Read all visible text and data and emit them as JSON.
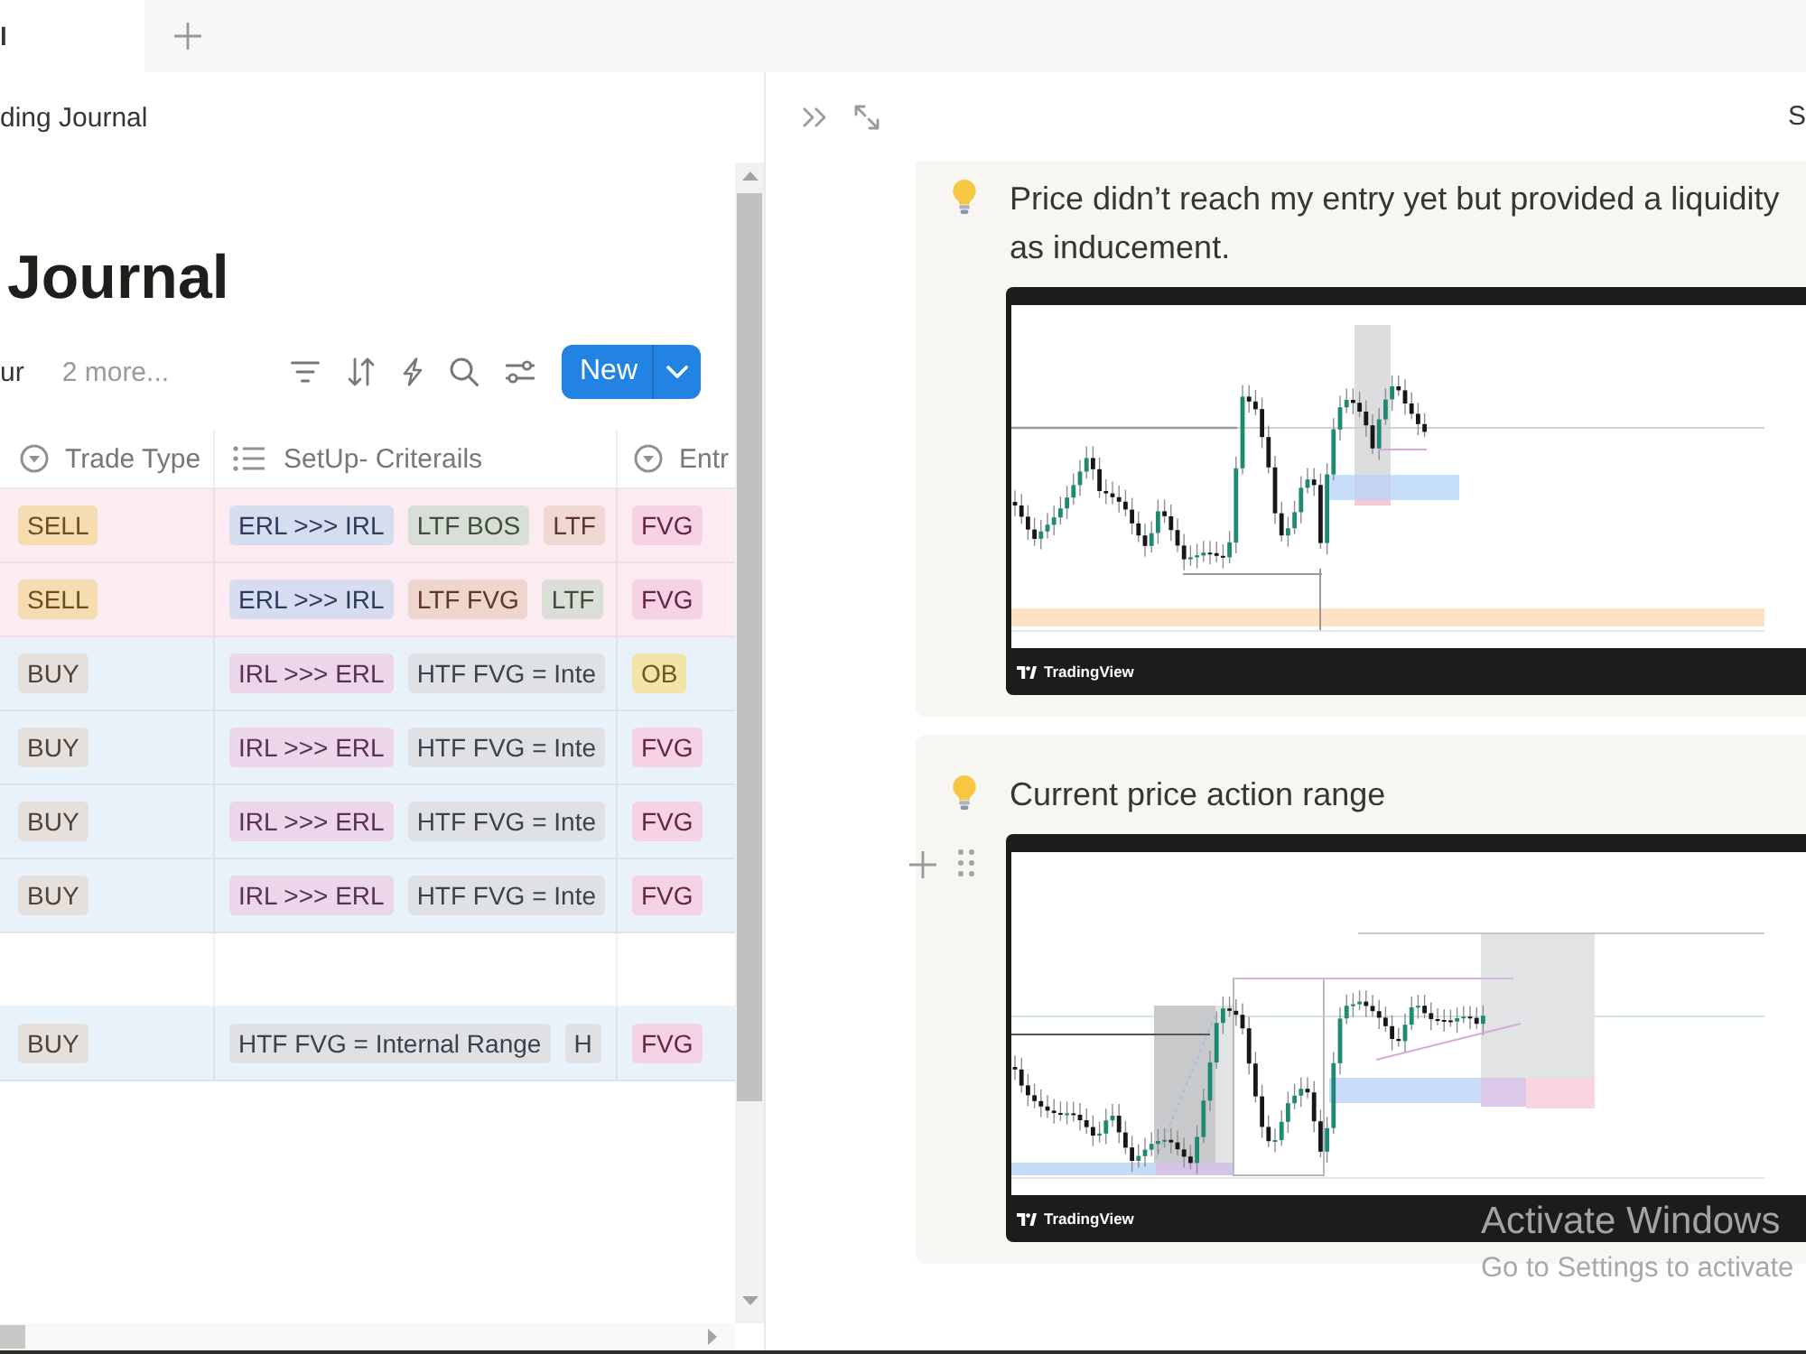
{
  "tab_bar": {
    "tabs": [
      {
        "label": "l",
        "selected": true
      }
    ]
  },
  "breadcrumb": "ding Journal",
  "database": {
    "title": "Journal",
    "views": [
      {
        "label": "ur",
        "selected": true
      }
    ],
    "more_views": "2 more...",
    "new_button": "New"
  },
  "table": {
    "columns": [
      {
        "label": "Trade Type",
        "kind": "select"
      },
      {
        "label": "SetUp- Criterails",
        "kind": "multi_select"
      },
      {
        "label": "Entr",
        "kind": "select"
      }
    ],
    "rows": [
      {
        "color": "#fcecf1",
        "cells": [
          [
            {
              "text": "SELL",
              "color": "#f5dcb1"
            }
          ],
          [
            {
              "text": "ERL >>> IRL",
              "color": "#d5ddef"
            },
            {
              "text": "LTF BOS",
              "color": "#d8dfd6"
            },
            {
              "text": "LTF",
              "color": "#eed8d1"
            }
          ],
          [
            {
              "text": "FVG",
              "color": "#f6d2e5"
            }
          ]
        ]
      },
      {
        "color": "#fcecf1",
        "cells": [
          [
            {
              "text": "SELL",
              "color": "#f5dcb1"
            }
          ],
          [
            {
              "text": "ERL >>> IRL",
              "color": "#d5ddef"
            },
            {
              "text": "LTF FVG",
              "color": "#eed6cf"
            },
            {
              "text": "LTF",
              "color": "#dadfd8"
            }
          ],
          [
            {
              "text": "FVG",
              "color": "#f6d2e5"
            }
          ]
        ]
      },
      {
        "color": "#e9f2fa",
        "cells": [
          [
            {
              "text": "BUY",
              "color": "#e6e0dc"
            }
          ],
          [
            {
              "text": "IRL >>> ERL",
              "color": "#ecd6e9"
            },
            {
              "text": "HTF FVG = Inte",
              "color": "#dfe1e5"
            }
          ],
          [
            {
              "text": "OB",
              "color": "#f3e5a8"
            }
          ]
        ]
      },
      {
        "color": "#e9f2fa",
        "cells": [
          [
            {
              "text": "BUY",
              "color": "#e6e0dc"
            }
          ],
          [
            {
              "text": "IRL >>> ERL",
              "color": "#ecd6e9"
            },
            {
              "text": "HTF FVG = Inte",
              "color": "#dfe1e5"
            }
          ],
          [
            {
              "text": "FVG",
              "color": "#f6d2e5"
            }
          ]
        ]
      },
      {
        "color": "#e9f2fa",
        "cells": [
          [
            {
              "text": "BUY",
              "color": "#e6e0dc"
            }
          ],
          [
            {
              "text": "IRL >>> ERL",
              "color": "#ecd6e9"
            },
            {
              "text": "HTF FVG = Inte",
              "color": "#dfe1e5"
            }
          ],
          [
            {
              "text": "FVG",
              "color": "#f6d2e5"
            }
          ]
        ]
      },
      {
        "color": "#e9f2fa",
        "cells": [
          [
            {
              "text": "BUY",
              "color": "#e6e0dc"
            }
          ],
          [
            {
              "text": "IRL >>> ERL",
              "color": "#ecd6e9"
            },
            {
              "text": "HTF FVG = Inte",
              "color": "#dfe1e5"
            }
          ],
          [
            {
              "text": "FVG",
              "color": "#f6d2e5"
            }
          ]
        ]
      },
      {
        "color": "#ffffff"
      },
      {
        "color": "#e9f2fa",
        "cells": [
          [
            {
              "text": "BUY",
              "color": "#e6e0dc"
            }
          ],
          [
            {
              "text": "HTF FVG = Internal Range",
              "color": "#dfe1e5"
            },
            {
              "text": "H",
              "color": "#dfe1e5"
            }
          ],
          [
            {
              "text": "FVG",
              "color": "#f6d2e5"
            }
          ]
        ]
      }
    ]
  },
  "right_pane": {
    "header_label": "S",
    "callouts": [
      {
        "text": "Price didn’t reach my entry yet but provided a liquidity as inducement.",
        "hovered": false,
        "chart_image": {
          "brand_label": "TradingView"
        }
      },
      {
        "text": "Current price action range",
        "hovered": true,
        "chart_image": {
          "brand_label": "TradingView"
        }
      }
    ]
  },
  "os_overlay": {
    "title": "Activate Windows",
    "message": "Go to Settings to activate"
  }
}
